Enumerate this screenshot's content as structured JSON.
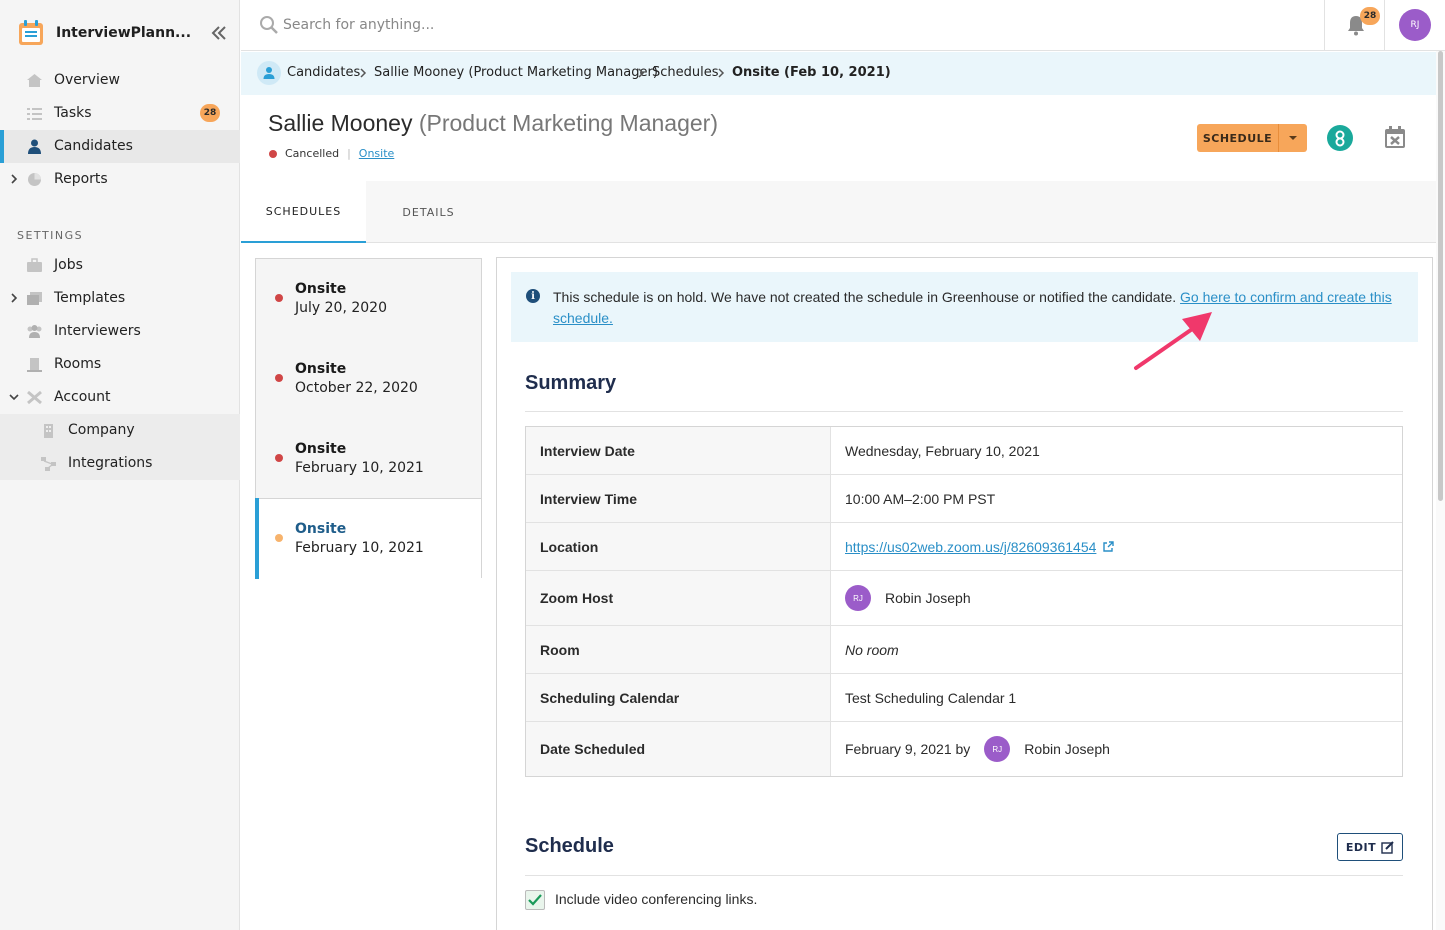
{
  "app": {
    "title": "InterviewPlann..."
  },
  "sidebar": {
    "items": [
      {
        "label": "Overview"
      },
      {
        "label": "Tasks",
        "badge": "28"
      },
      {
        "label": "Candidates"
      },
      {
        "label": "Reports"
      }
    ],
    "settings_title": "SETTINGS",
    "settings_items": [
      {
        "label": "Jobs"
      },
      {
        "label": "Templates"
      },
      {
        "label": "Interviewers"
      },
      {
        "label": "Rooms"
      },
      {
        "label": "Account"
      },
      {
        "label": "Company"
      },
      {
        "label": "Integrations"
      }
    ]
  },
  "topbar": {
    "search_placeholder": "Search for anything...",
    "notifications_count": "28",
    "user_initials": "RJ"
  },
  "breadcrumb": {
    "items": [
      "Candidates",
      "Sallie Mooney (Product Marketing Manager)",
      "Schedules",
      "Onsite (Feb 10, 2021)"
    ]
  },
  "header": {
    "name": "Sallie Mooney",
    "role": "(Product Marketing Manager)",
    "status": "Cancelled",
    "stage_link": "Onsite",
    "schedule_button": "SCHEDULE"
  },
  "tabs": [
    "SCHEDULES",
    "DETAILS"
  ],
  "schedules": [
    {
      "title": "Onsite",
      "date": "July 20, 2020",
      "status_color": "#d04646"
    },
    {
      "title": "Onsite",
      "date": "October 22, 2020",
      "status_color": "#d04646"
    },
    {
      "title": "Onsite",
      "date": "February 10, 2021",
      "status_color": "#d04646"
    },
    {
      "title": "Onsite",
      "date": "February 10, 2021",
      "status_color": "#f7b36c"
    }
  ],
  "alert": {
    "text": "This schedule is on hold. We have not created the schedule in Greenhouse or notified the candidate. ",
    "link": "Go here to confirm and create this schedule."
  },
  "summary": {
    "title": "Summary",
    "rows": [
      {
        "key": "Interview Date",
        "value": "Wednesday, February 10, 2021"
      },
      {
        "key": "Interview Time",
        "value": "10:00 AM–2:00 PM PST"
      },
      {
        "key": "Location",
        "value": "https://us02web.zoom.us/j/82609361454"
      },
      {
        "key": "Zoom Host",
        "value": "Robin Joseph",
        "avatar": "RJ"
      },
      {
        "key": "Room",
        "value": "No room"
      },
      {
        "key": "Scheduling Calendar",
        "value": "Test Scheduling Calendar 1"
      },
      {
        "key": "Date Scheduled",
        "value": "February 9, 2021 by",
        "user": "Robin Joseph",
        "avatar": "RJ"
      }
    ]
  },
  "schedule_section": {
    "title": "Schedule",
    "edit_button": "EDIT",
    "checkbox_label": "Include video conferencing links."
  },
  "colors": {
    "accent": "#2a9fd6",
    "orange": "#f7a65a",
    "cancelled": "#d04646",
    "greenhouse": "#1aa99b",
    "avatar": "#9b5cc9",
    "arrow": "#f0386b"
  }
}
